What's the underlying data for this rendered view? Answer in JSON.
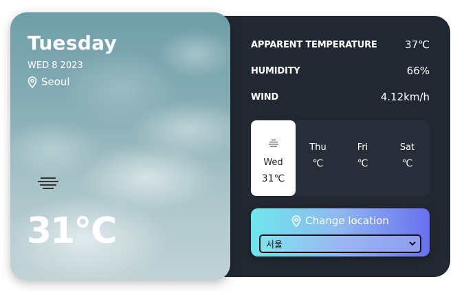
{
  "hero": {
    "day": "Tuesday",
    "date": "WED 8 2023",
    "city": "Seoul",
    "temperature": "31℃",
    "weather_icon": "haze-icon"
  },
  "stats": [
    {
      "label": "APPARENT TEMPERATURE",
      "value": "37℃"
    },
    {
      "label": "HUMIDITY",
      "value": "66%"
    },
    {
      "label": "WIND",
      "value": "4.12km/h"
    }
  ],
  "week": [
    {
      "name": "Wed",
      "temp": "31℃",
      "icon": "haze-icon",
      "active": true
    },
    {
      "name": "Thu",
      "temp": "℃",
      "active": false
    },
    {
      "name": "Fri",
      "temp": "℃",
      "active": false
    },
    {
      "name": "Sat",
      "temp": "℃",
      "active": false
    }
  ],
  "location_control": {
    "button_label": "Change location",
    "selected_option": "서울"
  },
  "colors": {
    "panel": "#222831",
    "week_bg": "#272e39",
    "accent_start": "#6fe6ec",
    "accent_end": "#6a6ff0"
  }
}
